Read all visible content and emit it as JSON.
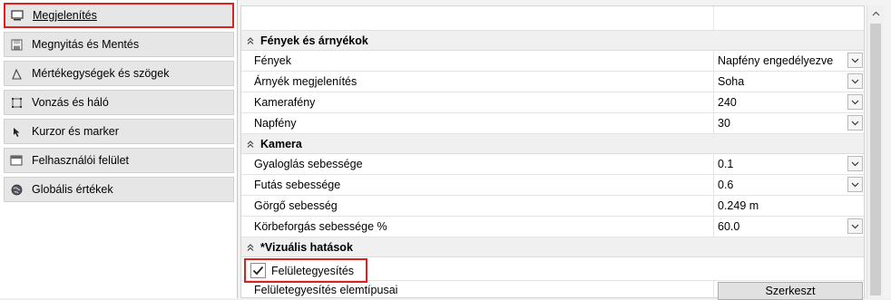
{
  "sidebar": {
    "items": [
      {
        "label": "Megjelenítés",
        "icon": "monitor-icon"
      },
      {
        "label": "Megnyitás és Mentés",
        "icon": "save-icon"
      },
      {
        "label": "Mértékegységek és szögek",
        "icon": "angle-icon"
      },
      {
        "label": "Vonzás és háló",
        "icon": "grid-icon"
      },
      {
        "label": "Kurzor és marker",
        "icon": "cursor-icon"
      },
      {
        "label": "Felhasználói felület",
        "icon": "window-icon"
      },
      {
        "label": "Globális értékek",
        "icon": "globe-icon"
      }
    ],
    "active_index": 0
  },
  "sections": {
    "lights": {
      "title": "Fények és árnyékok",
      "rows": [
        {
          "name": "Fények",
          "value": "Napfény engedélyezve"
        },
        {
          "name": "Árnyék megjelenítés",
          "value": "Soha"
        },
        {
          "name": "Kamerafény",
          "value": "240"
        },
        {
          "name": "Napfény",
          "value": "30"
        }
      ]
    },
    "camera": {
      "title": "Kamera",
      "rows": [
        {
          "name": "Gyaloglás sebessége",
          "value": "0.1"
        },
        {
          "name": "Futás sebessége",
          "value": "0.6"
        },
        {
          "name": "Görgő sebesség",
          "value": "0.249 m"
        },
        {
          "name": "Körbeforgás sebessége %",
          "value": "60.0"
        }
      ]
    },
    "visual": {
      "title": "*Vizuális hatások",
      "checkbox_label": "Felületegyesítés",
      "checkbox_checked": true,
      "edit_row_name": "Felületegyesítés elemtípusai",
      "edit_button_label": "Szerkeszt"
    }
  },
  "colors": {
    "highlight": "#e02020",
    "section_bg": "#f0f0f0"
  }
}
